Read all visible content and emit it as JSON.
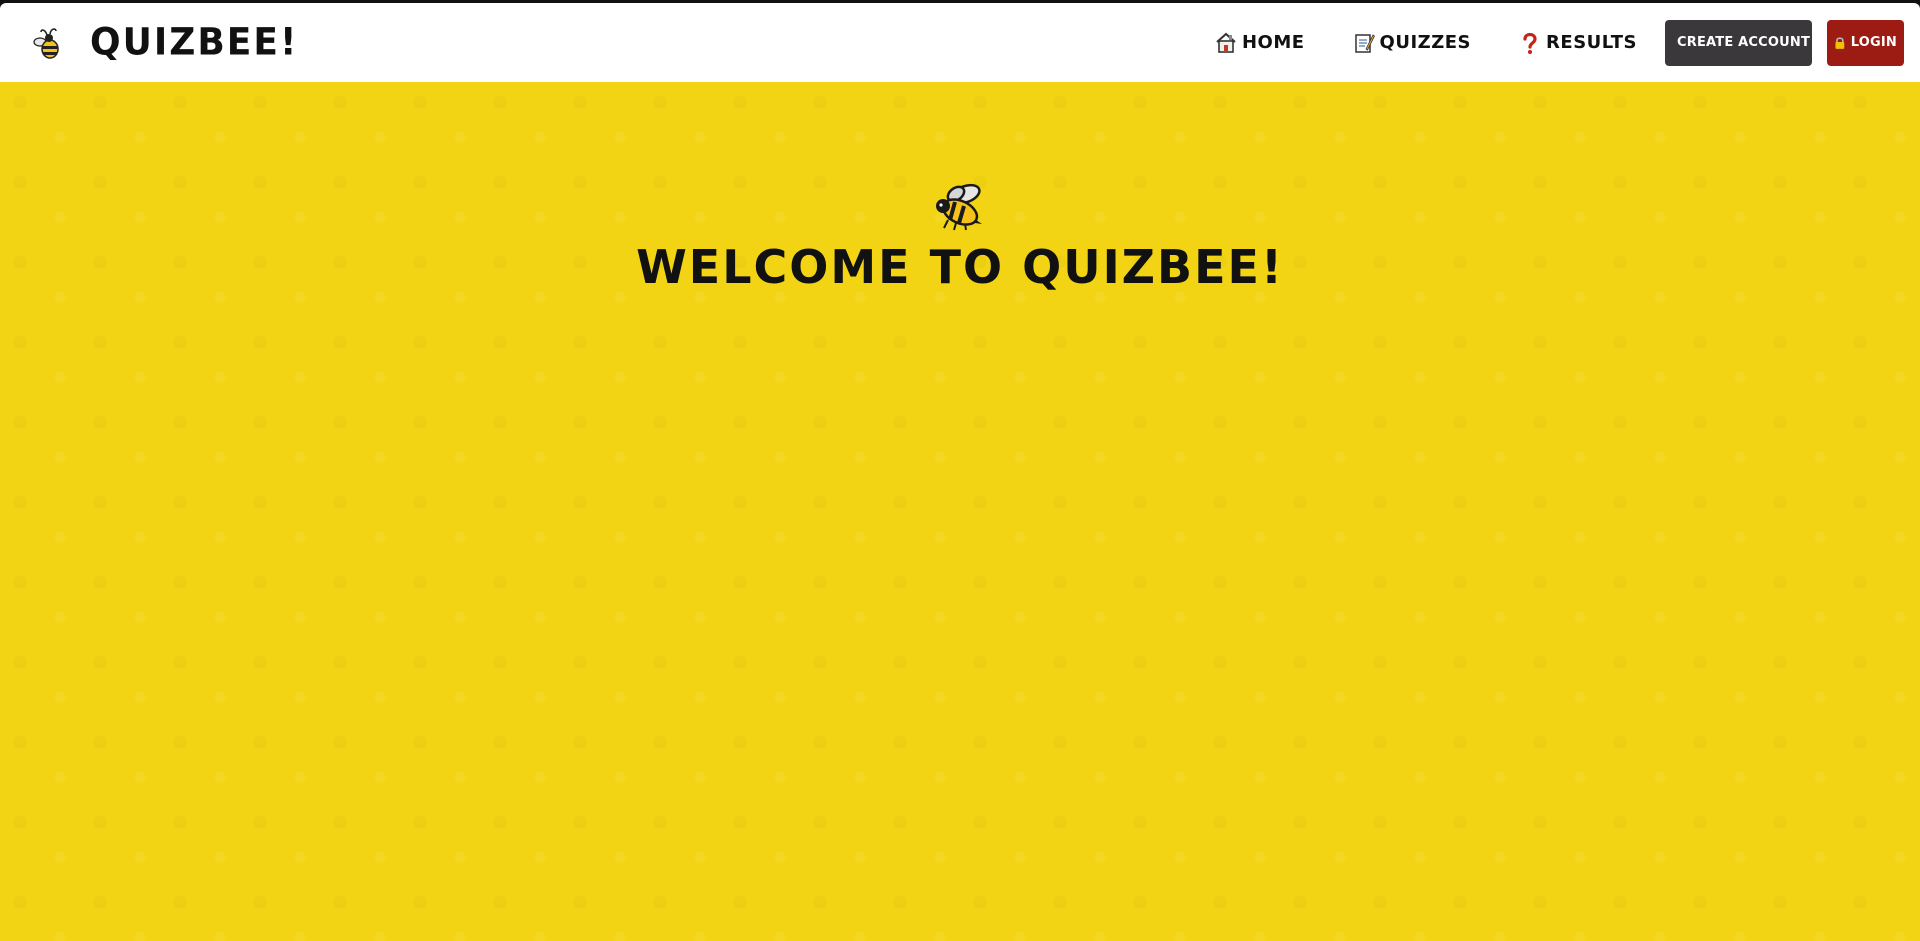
{
  "app": {
    "brand_title": "QUIZBEE!",
    "brand_icon": "bee-icon"
  },
  "nav": {
    "links": [
      {
        "label": "HOME",
        "icon": "house-icon"
      },
      {
        "label": "QUIZZES",
        "icon": "memo-icon"
      },
      {
        "label": "RESULTS",
        "icon": "question-mark-icon"
      }
    ],
    "create_account_label": "CREATE ACCOUNT",
    "create_account_icon": "clipboard-icon",
    "login_label": "LOGIN",
    "login_icon": "lock-icon"
  },
  "hero": {
    "title": "WELCOME TO QUIZBEE!",
    "icon": "bee-icon"
  },
  "colors": {
    "background_yellow": "#f2d414",
    "navbar_white": "#ffffff",
    "create_account_bg": "#3a383b",
    "login_bg": "#9c1b12",
    "text_dark": "#111111"
  }
}
